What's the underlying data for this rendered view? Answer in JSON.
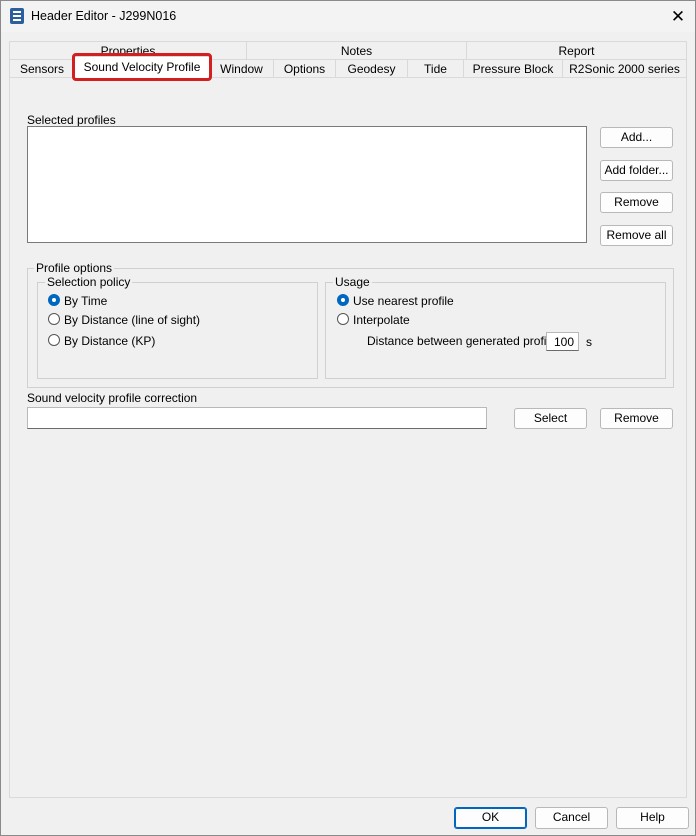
{
  "window": {
    "title": "Header Editor - J299N016",
    "close_symbol": "✕"
  },
  "tabs": {
    "row1": [
      "Properties",
      "Notes",
      "Report"
    ],
    "row2": [
      "Sensors",
      "Sound Velocity Profile",
      "Window",
      "Options",
      "Geodesy",
      "Tide",
      "Pressure Block",
      "R2Sonic 2000 series"
    ],
    "active": "Sound Velocity Profile"
  },
  "selected_profiles": {
    "label": "Selected profiles",
    "items": [],
    "buttons": {
      "add": "Add...",
      "add_folder": "Add folder...",
      "remove": "Remove",
      "remove_all": "Remove all"
    }
  },
  "profile_options": {
    "label": "Profile options",
    "selection_policy": {
      "label": "Selection policy",
      "options": [
        "By Time",
        "By Distance (line of sight)",
        "By Distance (KP)"
      ],
      "selected": "By Time"
    },
    "usage": {
      "label": "Usage",
      "options": [
        "Use nearest profile",
        "Interpolate"
      ],
      "selected": "Use nearest profile",
      "distance_label": "Distance between generated profiles",
      "distance_value": "100",
      "distance_unit": "s"
    }
  },
  "svp_correction": {
    "label": "Sound velocity profile correction",
    "value": "",
    "select_button": "Select",
    "remove_button": "Remove"
  },
  "dialog_buttons": {
    "ok": "OK",
    "cancel": "Cancel",
    "help": "Help"
  },
  "colors": {
    "highlight": "#d21f1f",
    "accent": "#0067c0"
  }
}
